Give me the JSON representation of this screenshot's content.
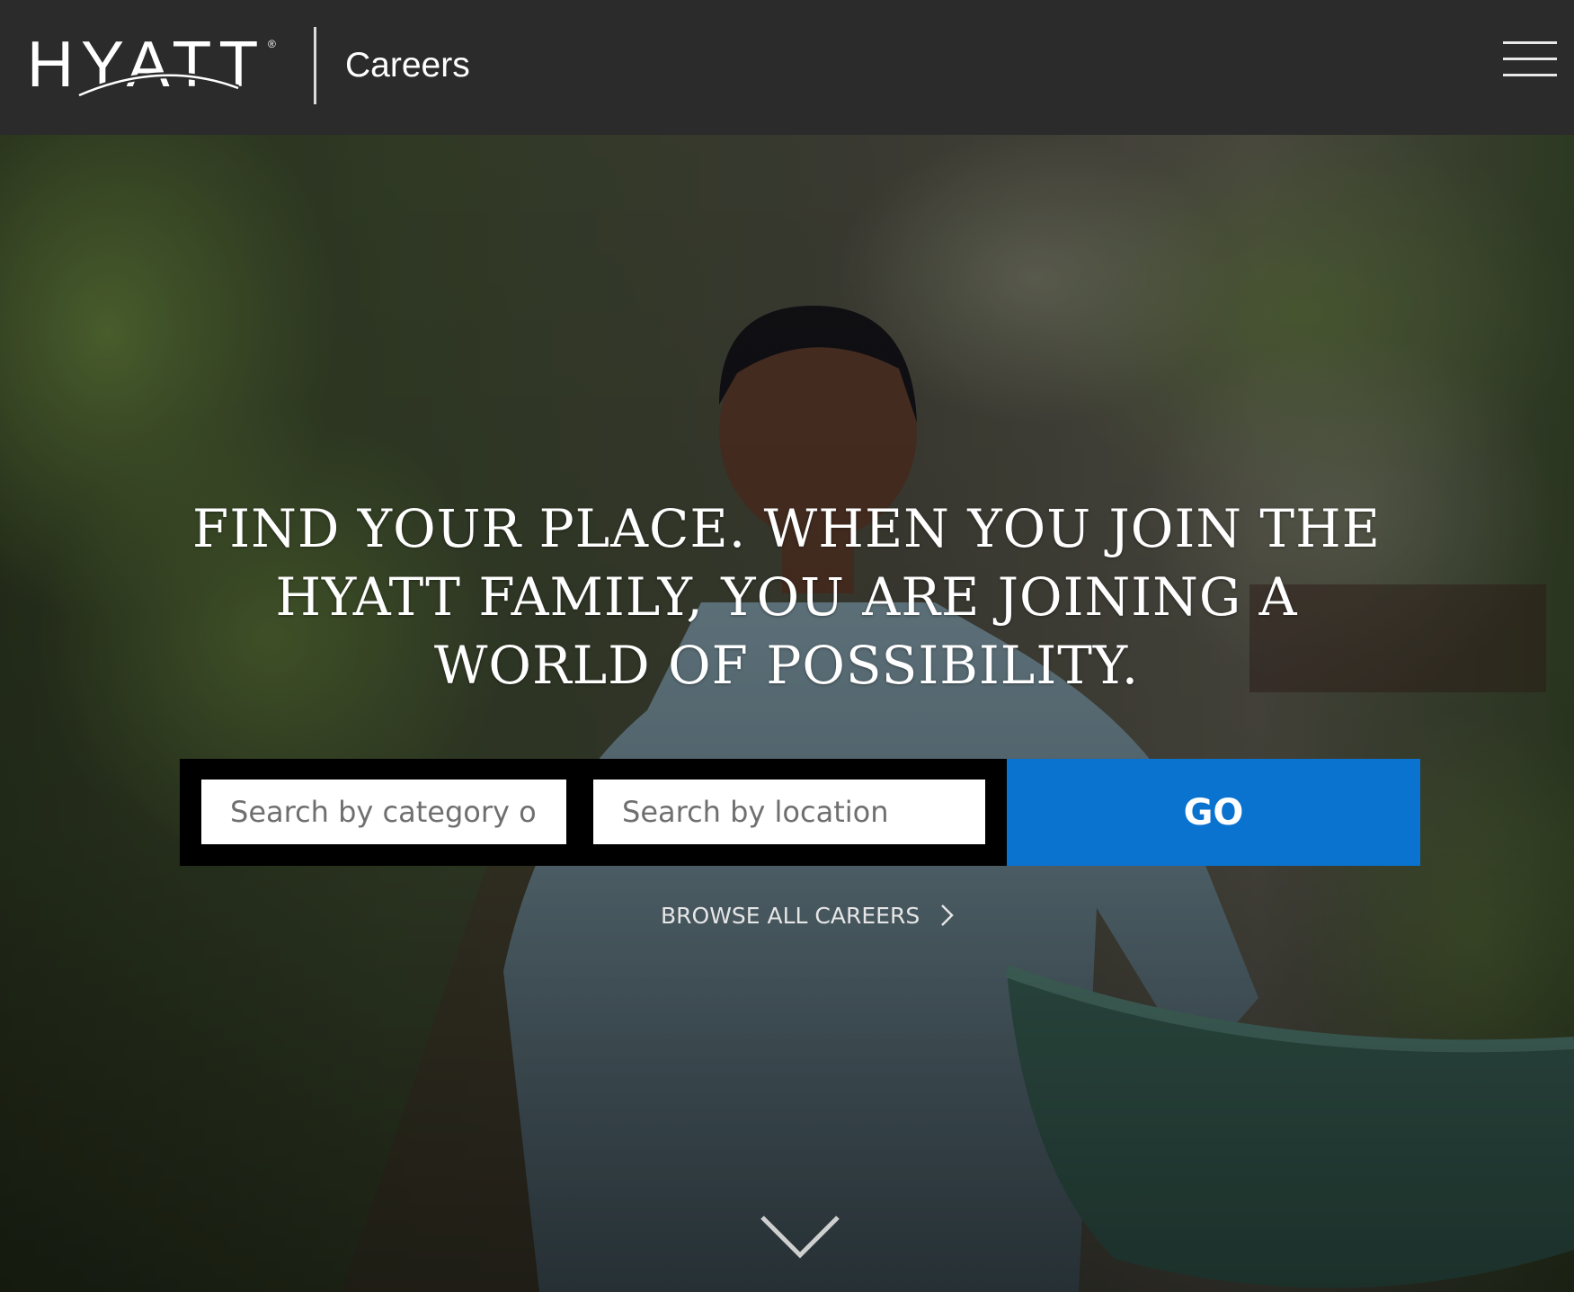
{
  "header": {
    "logo_text": "HYATT",
    "logo_mark": "®",
    "title": "Careers",
    "menu_icon": "hamburger-menu-icon"
  },
  "hero": {
    "image_subject": "hotel staff member in light blue uniform holding a green basin, garden path background",
    "headline": "FIND YOUR PLACE. WHEN YOU JOIN THE HYATT FAMILY, YOU ARE JOINING A WORLD OF POSSIBILITY."
  },
  "search": {
    "category_placeholder": "Search by category or",
    "location_placeholder": "Search by location",
    "go_label": "GO"
  },
  "browse": {
    "label": "BROWSE ALL CAREERS",
    "icon": "chevron-right-icon"
  },
  "scroll": {
    "icon": "chevron-down-icon"
  },
  "colors": {
    "header_bg": "#2b2b2b",
    "go_button": "#0a72cf",
    "search_frame": "#000000"
  }
}
